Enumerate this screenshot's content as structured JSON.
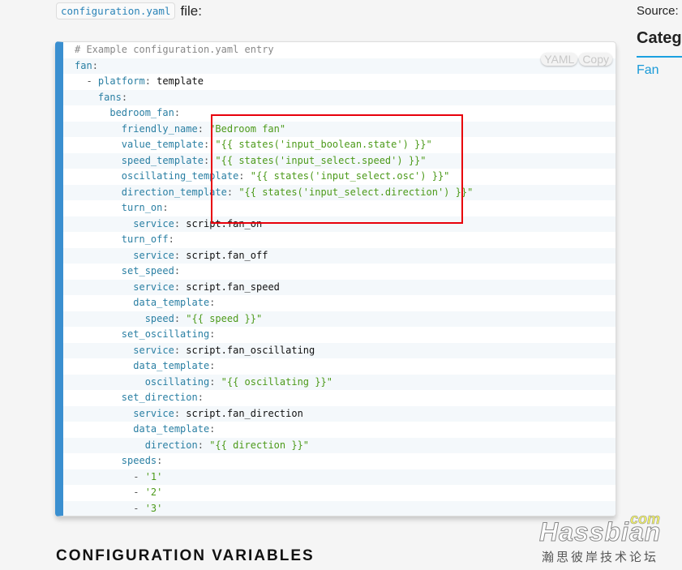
{
  "intro": {
    "code": "configuration.yaml",
    "text": "file:"
  },
  "code": {
    "buttons": {
      "lang": "YAML",
      "copy": "Copy"
    },
    "lines": [
      {
        "i": 0,
        "comment": "# Example configuration.yaml entry"
      },
      {
        "i": 0,
        "key": "fan"
      },
      {
        "i": 2,
        "dash": true,
        "key": "platform",
        "value": "template"
      },
      {
        "i": 4,
        "key": "fans"
      },
      {
        "i": 6,
        "key": "bedroom_fan"
      },
      {
        "i": 8,
        "key": "friendly_name",
        "str": "\"Bedroom fan\""
      },
      {
        "i": 8,
        "key": "value_template",
        "str": "\"{{ states('input_boolean.state') }}\""
      },
      {
        "i": 8,
        "key": "speed_template",
        "str": "\"{{ states('input_select.speed') }}\""
      },
      {
        "i": 8,
        "key": "oscillating_template",
        "str": "\"{{ states('input_select.osc') }}\""
      },
      {
        "i": 8,
        "key": "direction_template",
        "str": "\"{{ states('input_select.direction') }}\""
      },
      {
        "i": 8,
        "key": "turn_on"
      },
      {
        "i": 10,
        "key": "service",
        "value": "script.fan_on"
      },
      {
        "i": 8,
        "key": "turn_off"
      },
      {
        "i": 10,
        "key": "service",
        "value": "script.fan_off"
      },
      {
        "i": 8,
        "key": "set_speed"
      },
      {
        "i": 10,
        "key": "service",
        "value": "script.fan_speed"
      },
      {
        "i": 10,
        "key": "data_template"
      },
      {
        "i": 12,
        "key": "speed",
        "str": "\"{{ speed }}\""
      },
      {
        "i": 8,
        "key": "set_oscillating"
      },
      {
        "i": 10,
        "key": "service",
        "value": "script.fan_oscillating"
      },
      {
        "i": 10,
        "key": "data_template"
      },
      {
        "i": 12,
        "key": "oscillating",
        "str": "\"{{ oscillating }}\""
      },
      {
        "i": 8,
        "key": "set_direction"
      },
      {
        "i": 10,
        "key": "service",
        "value": "script.fan_direction"
      },
      {
        "i": 10,
        "key": "data_template"
      },
      {
        "i": 12,
        "key": "direction",
        "str": "\"{{ direction }}\""
      },
      {
        "i": 8,
        "key": "speeds"
      },
      {
        "i": 10,
        "dash": true,
        "str": "'1'"
      },
      {
        "i": 10,
        "dash": true,
        "str": "'2'"
      },
      {
        "i": 10,
        "dash": true,
        "str": "'3'"
      }
    ]
  },
  "sidebar": {
    "source": "Source:",
    "category_heading": "Categ",
    "category_link": "Fan"
  },
  "section_heading": "CONFIGURATION VARIABLES",
  "watermark": {
    "brand": "Hassbian",
    "tld": "com",
    "subtitle": "瀚思彼岸技术论坛"
  },
  "colors": {
    "accent": "#3a8fd0",
    "key": "#2a7fa3",
    "string": "#4c9a1a",
    "highlight_box": "#e8000b"
  }
}
